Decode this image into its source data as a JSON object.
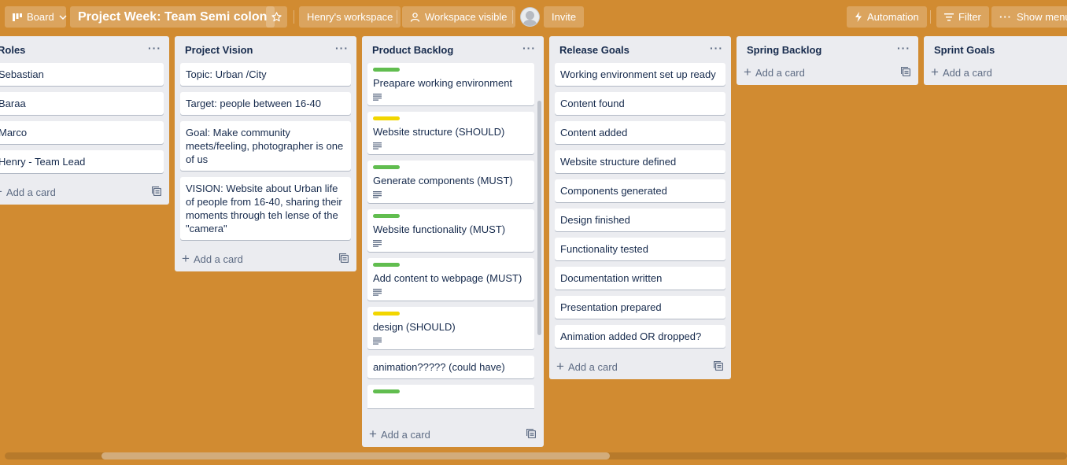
{
  "header": {
    "view_label": "Board",
    "board_title": "Project Week: Team Semi colon",
    "workspace_label": "Henry's workspace",
    "visibility_label": "Workspace visible",
    "invite_label": "Invite",
    "automation_label": "Automation",
    "filter_label": "Filter",
    "menu_label": "Show menu"
  },
  "lists": [
    {
      "title": "Roles",
      "cards": [
        {
          "text": "Sebastian"
        },
        {
          "text": "Baraa"
        },
        {
          "text": "Marco"
        },
        {
          "text": "Henry - Team Lead"
        }
      ],
      "add_label": "Add a card"
    },
    {
      "title": "Project Vision",
      "cards": [
        {
          "text": "Topic: Urban /City"
        },
        {
          "text": "Target: people between 16-40"
        },
        {
          "text": "Goal: Make community meets/feeling, photographer is one of us"
        },
        {
          "text": "VISION: Website about Urban life of people from 16-40, sharing their moments through teh lense of the \"camera\""
        }
      ],
      "add_label": "Add a card"
    },
    {
      "title": "Product Backlog",
      "cards": [
        {
          "text": "Preapare working environment",
          "label_color": "#61bd4f"
        },
        {
          "text": "Website structure (SHOULD)",
          "label_color": "#f2d600"
        },
        {
          "text": "Generate components (MUST)",
          "label_color": "#61bd4f"
        },
        {
          "text": "Website functionality (MUST)",
          "label_color": "#61bd4f"
        },
        {
          "text": "Add content to webpage (MUST)",
          "label_color": "#61bd4f"
        },
        {
          "text": "design (SHOULD)",
          "label_color": "#f2d600"
        },
        {
          "text": "animation????? (could have)"
        }
      ],
      "add_label": "Add a card"
    },
    {
      "title": "Release Goals",
      "cards": [
        {
          "text": "Working environment set up ready"
        },
        {
          "text": "Content found"
        },
        {
          "text": "Content added"
        },
        {
          "text": "Website structure defined"
        },
        {
          "text": "Components generated"
        },
        {
          "text": "Design finished"
        },
        {
          "text": "Functionality tested"
        },
        {
          "text": "Documentation written"
        },
        {
          "text": "Presentation prepared"
        },
        {
          "text": "Animation added OR dropped?"
        }
      ],
      "add_label": "Add a card"
    },
    {
      "title": "Spring Backlog",
      "add_label": "Add a card"
    },
    {
      "title": "Sprint Goals",
      "add_label": "Add a card"
    }
  ],
  "colors": {
    "board_background": "#d18b31",
    "label_green": "#61bd4f",
    "label_yellow": "#f2d600"
  }
}
